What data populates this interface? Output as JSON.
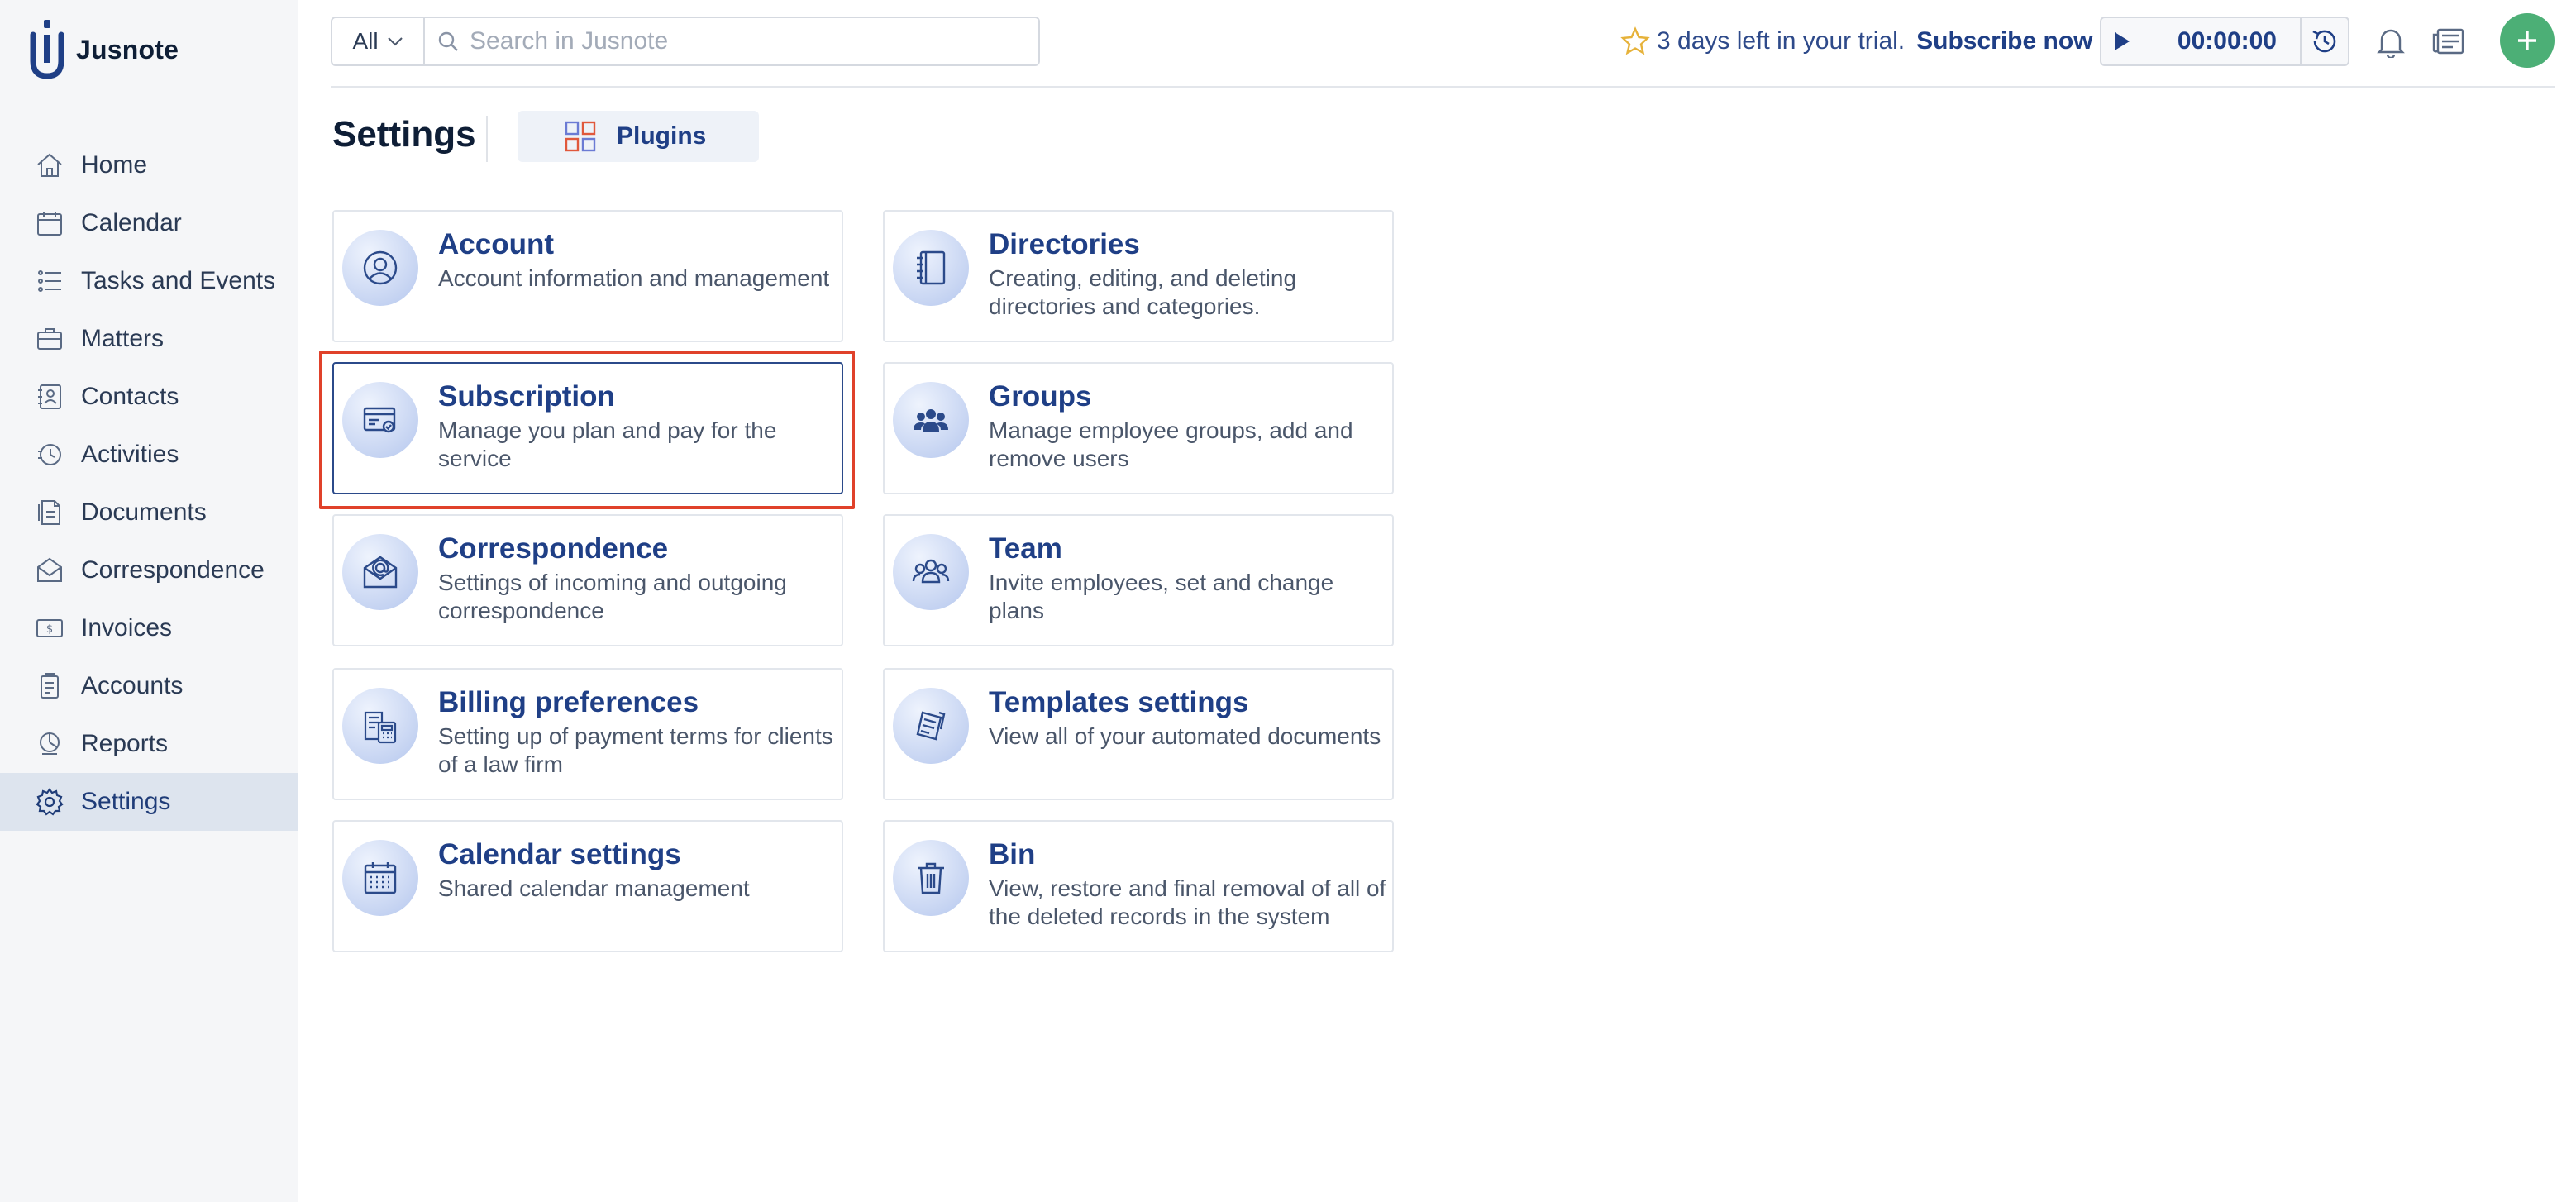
{
  "app": {
    "name": "Jusnote"
  },
  "sidebar": {
    "items": [
      {
        "label": "Home",
        "icon": "home-icon"
      },
      {
        "label": "Calendar",
        "icon": "calendar-icon"
      },
      {
        "label": "Tasks and Events",
        "icon": "tasks-icon"
      },
      {
        "label": "Matters",
        "icon": "matters-icon"
      },
      {
        "label": "Contacts",
        "icon": "contacts-icon"
      },
      {
        "label": "Activities",
        "icon": "activities-icon"
      },
      {
        "label": "Documents",
        "icon": "documents-icon"
      },
      {
        "label": "Correspondence",
        "icon": "correspondence-icon"
      },
      {
        "label": "Invoices",
        "icon": "invoices-icon"
      },
      {
        "label": "Accounts",
        "icon": "accounts-icon"
      },
      {
        "label": "Reports",
        "icon": "reports-icon"
      },
      {
        "label": "Settings",
        "icon": "settings-icon",
        "active": true
      }
    ]
  },
  "topbar": {
    "filter_value": "All",
    "search_placeholder": "Search in Jusnote",
    "trial_text": "3 days left in your trial.",
    "subscribe_label": "Subscribe now",
    "timer_value": "00:00:00"
  },
  "page": {
    "title": "Settings",
    "plugins_tab": "Plugins"
  },
  "cards": {
    "account": {
      "title": "Account",
      "desc": "Account information and management"
    },
    "directories": {
      "title": "Directories",
      "desc": "Creating, editing, and deleting directories and categories."
    },
    "subscription": {
      "title": "Subscription",
      "desc": "Manage you plan and pay for the service"
    },
    "groups": {
      "title": "Groups",
      "desc": "Manage employee groups, add and remove users"
    },
    "correspondence": {
      "title": "Correspondence",
      "desc": "Settings of incoming and outgoing correspondence"
    },
    "team": {
      "title": "Team",
      "desc": "Invite employees, set and change plans"
    },
    "billing": {
      "title": "Billing preferences",
      "desc": "Setting up of payment terms for clients of a law firm"
    },
    "templates": {
      "title": "Templates settings",
      "desc": "View all of your automated documents"
    },
    "calendar": {
      "title": "Calendar settings",
      "desc": "Shared calendar management"
    },
    "bin": {
      "title": "Bin",
      "desc": "View, restore and final removal of all of the deleted records in the system"
    }
  },
  "colors": {
    "accent": "#1f3f86",
    "highlight": "#e0412a",
    "add_button": "#4caf76",
    "active_nav_bg": "#dde4ee"
  }
}
